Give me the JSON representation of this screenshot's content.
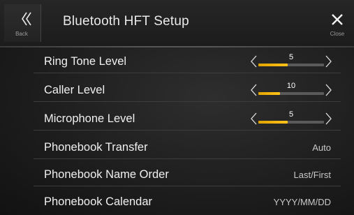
{
  "header": {
    "back_label": "Back",
    "title": "Bluetooth HFT Setup",
    "close_label": "Close"
  },
  "rows": [
    {
      "label": "Ring Tone Level",
      "level": "5",
      "fill_fraction": 0.45
    },
    {
      "label": "Caller Level",
      "level": "10",
      "fill_fraction": 0.33
    },
    {
      "label": "Microphone Level",
      "level": "5",
      "fill_fraction": 0.45
    },
    {
      "label": "Phonebook Transfer",
      "value": "Auto"
    },
    {
      "label": "Phonebook Name Order",
      "value": "Last/First"
    },
    {
      "label": "Phonebook Calendar",
      "value": "YYYY/MM/DD"
    }
  ],
  "colors": {
    "accent": "#ffc21a",
    "text": "#f0f0f0",
    "value_text": "#c8c8c8",
    "background": "#1e1e1e"
  },
  "icons": {
    "back": "double-chevron-left-icon",
    "close": "close-x-icon",
    "decrease": "chevron-left-icon",
    "increase": "chevron-right-icon"
  }
}
